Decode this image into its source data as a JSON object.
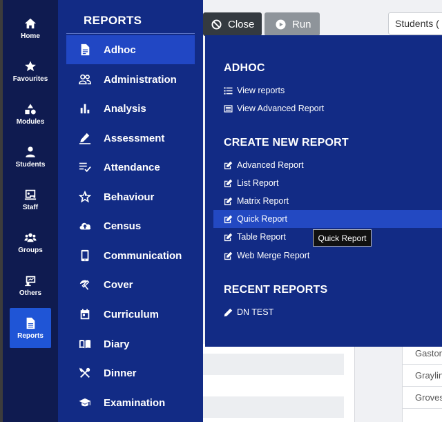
{
  "rail": {
    "items": [
      {
        "label": "Home",
        "icon": "home-icon"
      },
      {
        "label": "Favourites",
        "icon": "star-icon"
      },
      {
        "label": "Modules",
        "icon": "shapes-icon"
      },
      {
        "label": "Students",
        "icon": "user-icon"
      },
      {
        "label": "Staff",
        "icon": "chalkboard-icon"
      },
      {
        "label": "Groups",
        "icon": "users-icon"
      },
      {
        "label": "Others",
        "icon": "presentation-icon"
      },
      {
        "label": "Reports",
        "icon": "file-icon"
      }
    ],
    "active": "Reports",
    "active_color": "#1f55d6"
  },
  "reports_menu": {
    "title": "REPORTS",
    "items": [
      {
        "label": "Adhoc",
        "icon": "file-text-icon"
      },
      {
        "label": "Administration",
        "icon": "people-icon"
      },
      {
        "label": "Analysis",
        "icon": "bar-chart-icon"
      },
      {
        "label": "Assessment",
        "icon": "pen-icon"
      },
      {
        "label": "Attendance",
        "icon": "list-check-icon"
      },
      {
        "label": "Behaviour",
        "icon": "star-outline-icon"
      },
      {
        "label": "Census",
        "icon": "cloud-upload-icon"
      },
      {
        "label": "Communication",
        "icon": "phone-icon"
      },
      {
        "label": "Cover",
        "icon": "umbrella-icon"
      },
      {
        "label": "Curriculum",
        "icon": "calendar-icon"
      },
      {
        "label": "Diary",
        "icon": "book-icon"
      },
      {
        "label": "Dinner",
        "icon": "utensils-icon"
      },
      {
        "label": "Examination",
        "icon": "graduation-cap-icon"
      }
    ],
    "active": "Adhoc"
  },
  "toolbar": {
    "close_label": "Close",
    "run_label": "Run",
    "students_select": "Students ("
  },
  "flyout": {
    "adhoc": {
      "title": "ADHOC",
      "items": [
        {
          "label": "View reports",
          "icon": "list-icon"
        },
        {
          "label": "View Advanced Report",
          "icon": "table-list-icon"
        }
      ]
    },
    "create": {
      "title": "CREATE NEW REPORT",
      "items": [
        {
          "label": "Advanced Report",
          "icon": "edit-icon"
        },
        {
          "label": "List Report",
          "icon": "edit-icon"
        },
        {
          "label": "Matrix Report",
          "icon": "edit-icon"
        },
        {
          "label": "Quick Report",
          "icon": "edit-icon"
        },
        {
          "label": "Table Report",
          "icon": "edit-icon"
        },
        {
          "label": "Web Merge Report",
          "icon": "edit-icon"
        }
      ],
      "hovered": "Quick Report"
    },
    "recent": {
      "title": "RECENT REPORTS",
      "items": [
        {
          "label": "DN TEST",
          "icon": "pencil-icon"
        }
      ]
    }
  },
  "tooltip": "Quick Report",
  "background_table": {
    "rows": [
      "Gaston",
      "Graylin",
      "Groves"
    ]
  }
}
